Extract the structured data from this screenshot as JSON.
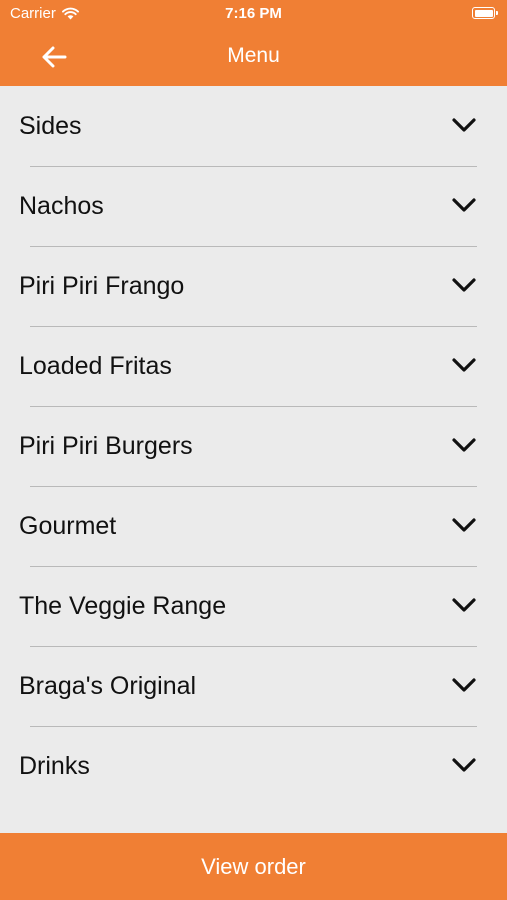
{
  "status_bar": {
    "carrier": "Carrier",
    "time": "7:16 PM"
  },
  "header": {
    "title": "Menu",
    "back_icon": "arrow-left-icon"
  },
  "menu": {
    "items": [
      {
        "label": "Sides"
      },
      {
        "label": "Nachos"
      },
      {
        "label": "Piri Piri Frango"
      },
      {
        "label": "Loaded Fritas"
      },
      {
        "label": "Piri Piri Burgers"
      },
      {
        "label": "Gourmet"
      },
      {
        "label": "The Veggie Range"
      },
      {
        "label": "Braga's Original"
      },
      {
        "label": "Drinks"
      }
    ],
    "expand_icon": "chevron-down-icon"
  },
  "footer": {
    "button_label": "View order"
  },
  "colors": {
    "accent": "#f07f34",
    "background": "#ebebeb",
    "divider": "#b9b9b9"
  }
}
